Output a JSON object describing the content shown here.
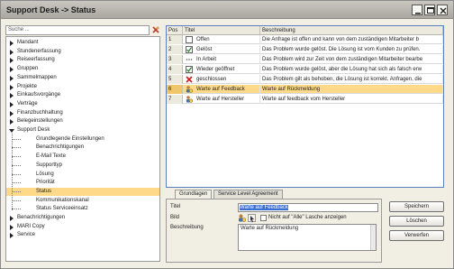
{
  "window": {
    "title": "Support Desk -> Status"
  },
  "search": {
    "value": "Suche ..."
  },
  "tree": [
    {
      "label": "Mandant",
      "level": 0,
      "expanded": false
    },
    {
      "label": "Stundenerfassung",
      "level": 0,
      "expanded": false
    },
    {
      "label": "Reiseerfassung",
      "level": 0,
      "expanded": false
    },
    {
      "label": "Gruppen",
      "level": 0,
      "expanded": false
    },
    {
      "label": "Sammelmappen",
      "level": 0,
      "expanded": false
    },
    {
      "label": "Projekte",
      "level": 0,
      "expanded": false
    },
    {
      "label": "Einkaufsvorgänge",
      "level": 0,
      "expanded": false
    },
    {
      "label": "Verträge",
      "level": 0,
      "expanded": false
    },
    {
      "label": "Finanzbuchhaltung",
      "level": 0,
      "expanded": false
    },
    {
      "label": "Belegeinstellungen",
      "level": 0,
      "expanded": false
    },
    {
      "label": "Support Desk",
      "level": 0,
      "expanded": true
    },
    {
      "label": "Grundlegende Einstellungen",
      "level": 1
    },
    {
      "label": "Benachrichtigungen",
      "level": 1
    },
    {
      "label": "E-Mail Texte",
      "level": 1
    },
    {
      "label": "Supporttyp",
      "level": 1
    },
    {
      "label": "Lösung",
      "level": 1
    },
    {
      "label": "Priorität",
      "level": 1
    },
    {
      "label": "Status",
      "level": 1,
      "selected": true
    },
    {
      "label": "Kommunikationskanal",
      "level": 1
    },
    {
      "label": "Status Serviceeinsatz",
      "level": 1
    },
    {
      "label": "Benachrichtigungen",
      "level": 0,
      "expanded": false
    },
    {
      "label": "MARI Copy",
      "level": 0,
      "expanded": false
    },
    {
      "label": "Service",
      "level": 0,
      "expanded": false
    }
  ],
  "grid": {
    "headers": {
      "pos": "Pos",
      "title": "Titel",
      "desc": "Beschreibung"
    },
    "rows": [
      {
        "pos": "1",
        "icon": "empty-checkbox-icon",
        "title": "Offen",
        "desc": "Die Anfrage ist offen und kann von dem zuständigen Mitarbeiter b"
      },
      {
        "pos": "2",
        "icon": "checked-box-icon",
        "title": "Gelöst",
        "desc": "Das Problem wurde gelöst. Die Lösung ist vom Kunden zu prüfen."
      },
      {
        "pos": "3",
        "icon": "dots-icon",
        "title": "In Arbeit",
        "desc": "Das Problem wird zur Zeit von dem zuständigen Mitarbeiter bearbe"
      },
      {
        "pos": "4",
        "icon": "checked-box-icon",
        "title": "Wieder geöffnet",
        "desc": "Das Problem wurde gelöst, aber die Lösung hat sich als falsch erw"
      },
      {
        "pos": "5",
        "icon": "red-x-icon",
        "title": "geschlossen",
        "desc": "Das Problem gilt als behoben, die Lösung ist korrekt. Anfragen, die"
      },
      {
        "pos": "6",
        "icon": "person-clock-icon",
        "title": "Warte auf Feedback",
        "desc": "Warte auf Rückmeldung",
        "selected": true
      },
      {
        "pos": "7",
        "icon": "person-clock-icon",
        "title": "Warte auf Hersteller",
        "desc": "Warte auf feedback vom Hersteller"
      }
    ]
  },
  "detail": {
    "tabs": [
      "Grundlagen",
      "Service Level Agreement"
    ],
    "active_tab": 0,
    "title_label": "Titel",
    "title_value": "Warte auf Feedback",
    "image_label": "Bild",
    "image_checkbox_label": "Nicht auf \"Alle\" Lasche anzeigen",
    "desc_label": "Beschreibung",
    "desc_value": "Warte auf Rückmeldung"
  },
  "buttons": {
    "save": "Speichern",
    "delete": "Löschen",
    "discard": "Verwerfen"
  }
}
